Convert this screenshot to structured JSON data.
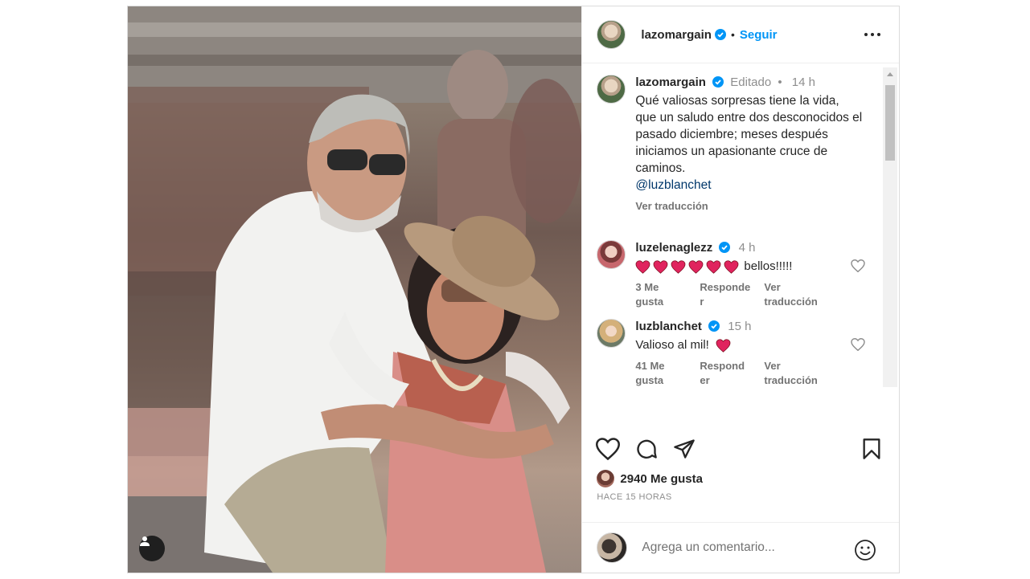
{
  "post": {
    "header": {
      "username": "lazomargain",
      "separator": "•",
      "follow_label": "Seguir"
    },
    "caption": {
      "username": "lazomargain",
      "edited": "Editado",
      "separator": "•",
      "time": "14 h",
      "text": "Qué valiosas sorpresas tiene la vida, que un saludo entre dos desconocidos el pasado diciembre; meses después iniciamos un apasionante cruce de caminos.",
      "mention": "@luzblanchet",
      "translate": "Ver traducción"
    },
    "comments": [
      {
        "username": "luzelenaglezz",
        "time": "4 h",
        "hearts": 6,
        "text": "bellos!!!!!",
        "likes_line1": "3 Me",
        "likes_line2": "gusta",
        "reply_line1": "Responde",
        "reply_line2": "r",
        "translate_line1": "Ver",
        "translate_line2": "traducción"
      },
      {
        "username": "luzblanchet",
        "time": "15 h",
        "text": "Valioso al mil!",
        "hearts": 1,
        "likes_line1": "41 Me",
        "likes_line2": "gusta",
        "reply_line1": "Respond",
        "reply_line2": "er",
        "translate_line1": "Ver",
        "translate_line2": "traducción"
      }
    ],
    "likes_label": "2940 Me gusta",
    "timestamp": "HACE 15 HORAS",
    "comment_input": {
      "placeholder": "Agrega un comentario..."
    }
  },
  "colors": {
    "accent": "#0095f6",
    "verified": "#0095f6",
    "heart": "#e0245e"
  }
}
